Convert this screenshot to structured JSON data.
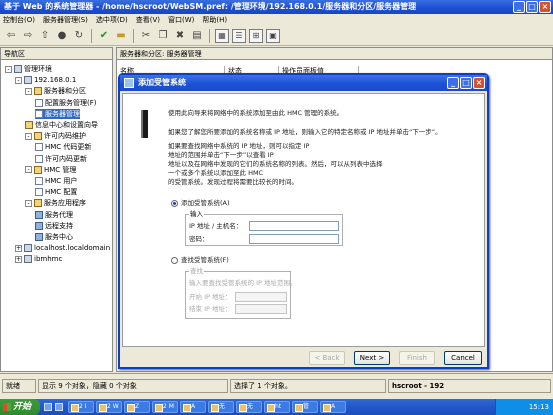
{
  "window": {
    "title": "基于 Web 的系统管理器 - /home/hscroot/WebSM.pref: /管理环境/192.168.0.1/服务器和分区/服务器管理",
    "controls": [
      "_",
      "□",
      "×"
    ]
  },
  "menu": [
    "控制台(O)",
    "服务器管理(S)",
    "选中项(D)",
    "查看(V)",
    "窗口(W)",
    "帮助(H)"
  ],
  "toolbar": {
    "icons": [
      "back-arrow-icon",
      "forward-arrow-icon",
      "up-icon",
      "stop-icon",
      "refresh-icon",
      "checkmark-icon",
      "folder-icon",
      "cut-icon",
      "copy-icon",
      "delete-icon",
      "paste-icon",
      "large-icons-view-icon",
      "details-view-icon",
      "tree-view-icon",
      "properties-icon"
    ]
  },
  "nav": {
    "header": "导航区",
    "tree": [
      {
        "label": "管理环境",
        "level": 0,
        "expander": "-",
        "icon": "host"
      },
      {
        "label": "192.168.0.1",
        "level": 1,
        "expander": "-",
        "icon": "host"
      },
      {
        "label": "服务器和分区",
        "level": 2,
        "expander": "-",
        "icon": "folder"
      },
      {
        "label": "配置服务管理(F)",
        "level": 3,
        "expander": "",
        "icon": "doc"
      },
      {
        "label": "服务器管理",
        "level": 3,
        "expander": "",
        "icon": "doc",
        "selected": true
      },
      {
        "label": "信息中心和设置向导",
        "level": 2,
        "expander": "",
        "icon": "folder"
      },
      {
        "label": "许可内码维护",
        "level": 2,
        "expander": "-",
        "icon": "folder"
      },
      {
        "label": "HMC 代码更新",
        "level": 3,
        "expander": "",
        "icon": "doc"
      },
      {
        "label": "许可内码更新",
        "level": 3,
        "expander": "",
        "icon": "doc"
      },
      {
        "label": "HMC 管理",
        "level": 2,
        "expander": "-",
        "icon": "folder"
      },
      {
        "label": "HMC 用户",
        "level": 3,
        "expander": "",
        "icon": "doc"
      },
      {
        "label": "HMC 配置",
        "level": 3,
        "expander": "",
        "icon": "doc"
      },
      {
        "label": "服务应用程序",
        "level": 2,
        "expander": "-",
        "icon": "folder"
      },
      {
        "label": "服务代理",
        "level": 3,
        "expander": "",
        "icon": "grp"
      },
      {
        "label": "远程支持",
        "level": 3,
        "expander": "",
        "icon": "grp"
      },
      {
        "label": "服务中心",
        "level": 3,
        "expander": "",
        "icon": "grp"
      },
      {
        "label": "localhost.localdomain",
        "level": 1,
        "expander": "+",
        "icon": "host"
      },
      {
        "label": "ibmhmc",
        "level": 1,
        "expander": "+",
        "icon": "host"
      }
    ]
  },
  "content": {
    "header": "服务器和分区: 服务器管理",
    "columns": [
      "名称",
      "状态",
      "操作员面板值"
    ]
  },
  "dialog": {
    "title": "添加受管系统",
    "intro": "使用此向导来将网络中的系统添加至由此 HMC 管理的系统。",
    "para1": "如果您了解您所要添加的系统名称或 IP 地址，则输入它的特定名称或 IP 地址并单击“下一步”。",
    "para2": [
      "如果要查找网络中系统的 IP 地址，则可以指定 IP",
      "地址的范围并单击“下一步”以查看 IP",
      "地址以及在网络中发现的它们的系统名称的列表。然后，可以从列表中选择",
      "一个或多个系统以添加至此 HMC",
      "的受管系统。发现过程将需要比较长的时间。"
    ],
    "option_add": "添加受管系统(A)",
    "group_input": "输入",
    "ip_label": "IP 地址 / 主机名：",
    "password_label": "密码：",
    "ip_value": "",
    "password_value": "",
    "option_find": "查找受管系统(F)",
    "group_range": "查找",
    "range_hint": "输入要查找受管系统的 IP 地址范围。",
    "start_label": "开始 IP 地址：",
    "end_label": "结束 IP 地址：",
    "buttons": {
      "back": "< Back",
      "next": "Next >",
      "finish": "Finish",
      "cancel": "Cancel"
    }
  },
  "status": {
    "ready": "就绪",
    "count": "显示 9 个对象，隐藏 0 个对象",
    "selected": "选择了 1 个对象。",
    "user": "hscroot - 192"
  },
  "taskbar": {
    "start": "开始",
    "tasks": [
      "2 I",
      "2 W",
      "Z",
      "2 M",
      "A",
      "无",
      "无",
      "ht",
      "管",
      "A"
    ],
    "clock": "15:13"
  }
}
